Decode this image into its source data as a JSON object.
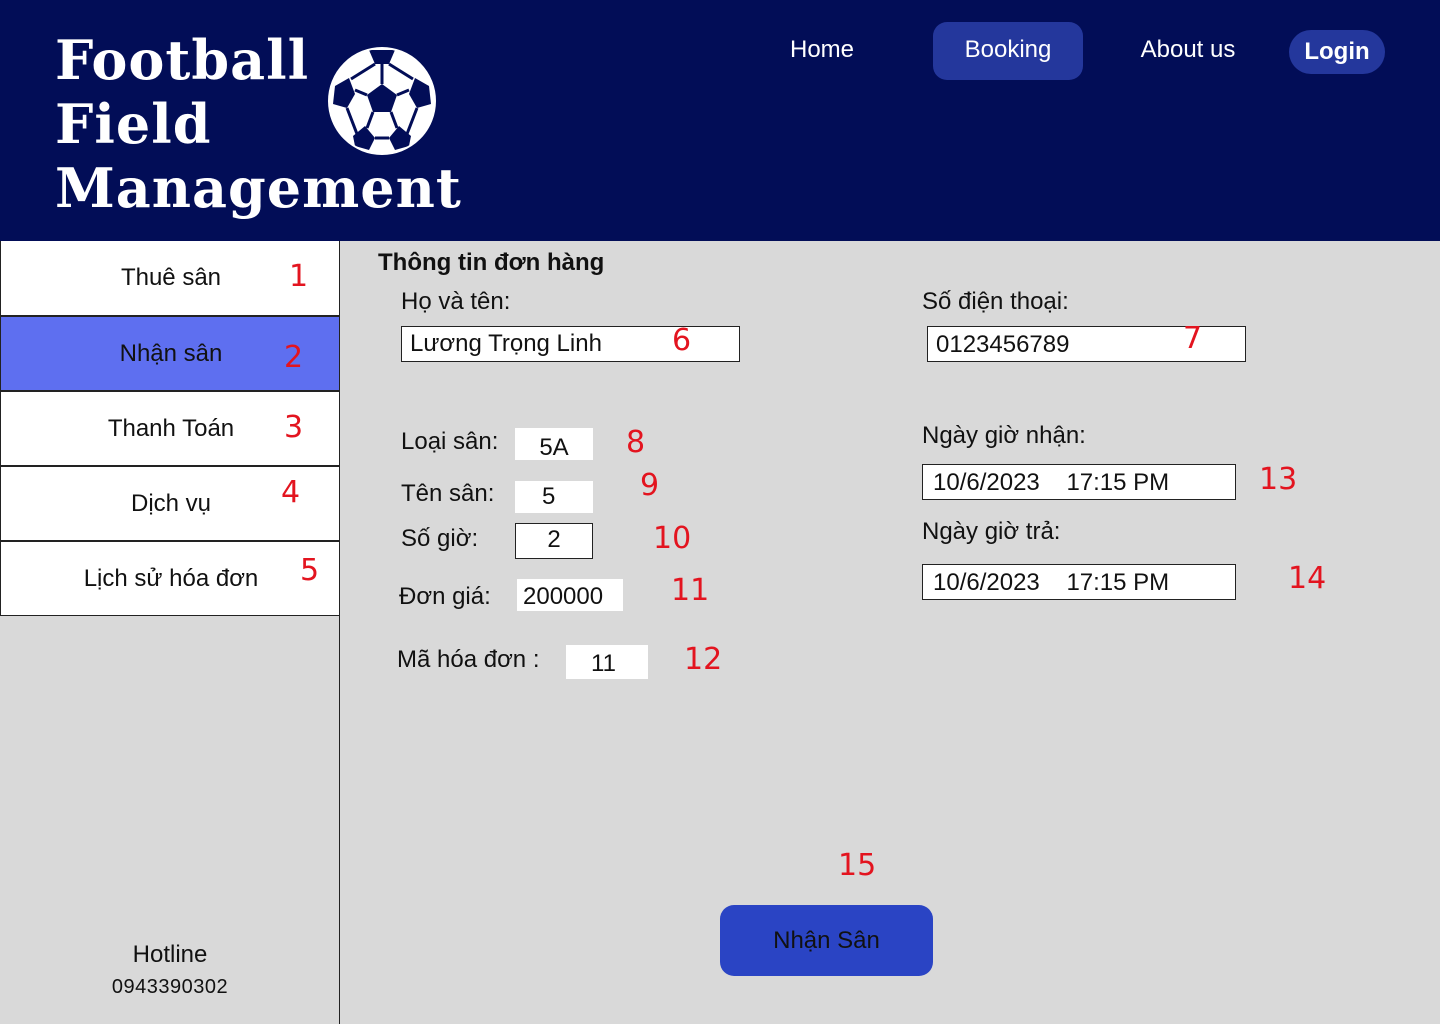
{
  "brand": {
    "line1": "Football",
    "line2": "Field",
    "line3": "Management"
  },
  "nav": {
    "home": "Home",
    "booking": "Booking",
    "about": "About us",
    "login": "Login"
  },
  "sidebar": {
    "items": [
      {
        "label": "Thuê sân",
        "num": "1"
      },
      {
        "label": "Nhận sân",
        "num": "2"
      },
      {
        "label": "Thanh Toán",
        "num": "3"
      },
      {
        "label": "Dịch vụ",
        "num": "4"
      },
      {
        "label": "Lịch sử hóa đơn",
        "num": "5"
      }
    ],
    "hotline_label": "Hotline",
    "hotline_number": "0943390302"
  },
  "form": {
    "title": "Thông tin đơn hàng",
    "name_label": "Họ và tên:",
    "name_value": "Lương Trọng Linh",
    "phone_label": "Số điện thoại:",
    "phone_value": "0123456789",
    "field_type_label": "Loại sân:",
    "field_type_value": "5A",
    "field_name_label": "Tên sân:",
    "field_name_value": "5",
    "hours_label": "Số giờ:",
    "hours_value": "2",
    "price_label": "Đơn giá:",
    "price_value": "200000",
    "invoice_label": "Mã hóa đơn :",
    "invoice_value": "11",
    "pickup_label": "Ngày giờ nhận:",
    "pickup_value": "10/6/2023    17:15 PM",
    "return_label": "Ngày giờ trả:",
    "return_value": "10/6/2023    17:15 PM",
    "submit_label": "Nhận Sân"
  },
  "annotations": {
    "n6": "6",
    "n7": "7",
    "n8": "8",
    "n9": "9",
    "n10": "10",
    "n11": "11",
    "n12": "12",
    "n13": "13",
    "n14": "14",
    "n15": "15"
  },
  "colors": {
    "header_bg": "#020d57",
    "accent": "#24379c",
    "active_sidebar": "#5e6ff0",
    "button": "#2a44c4",
    "annotation": "#e3141f",
    "page_bg": "#d9d9d9"
  },
  "icons": {
    "logo": "soccer-ball-icon"
  }
}
